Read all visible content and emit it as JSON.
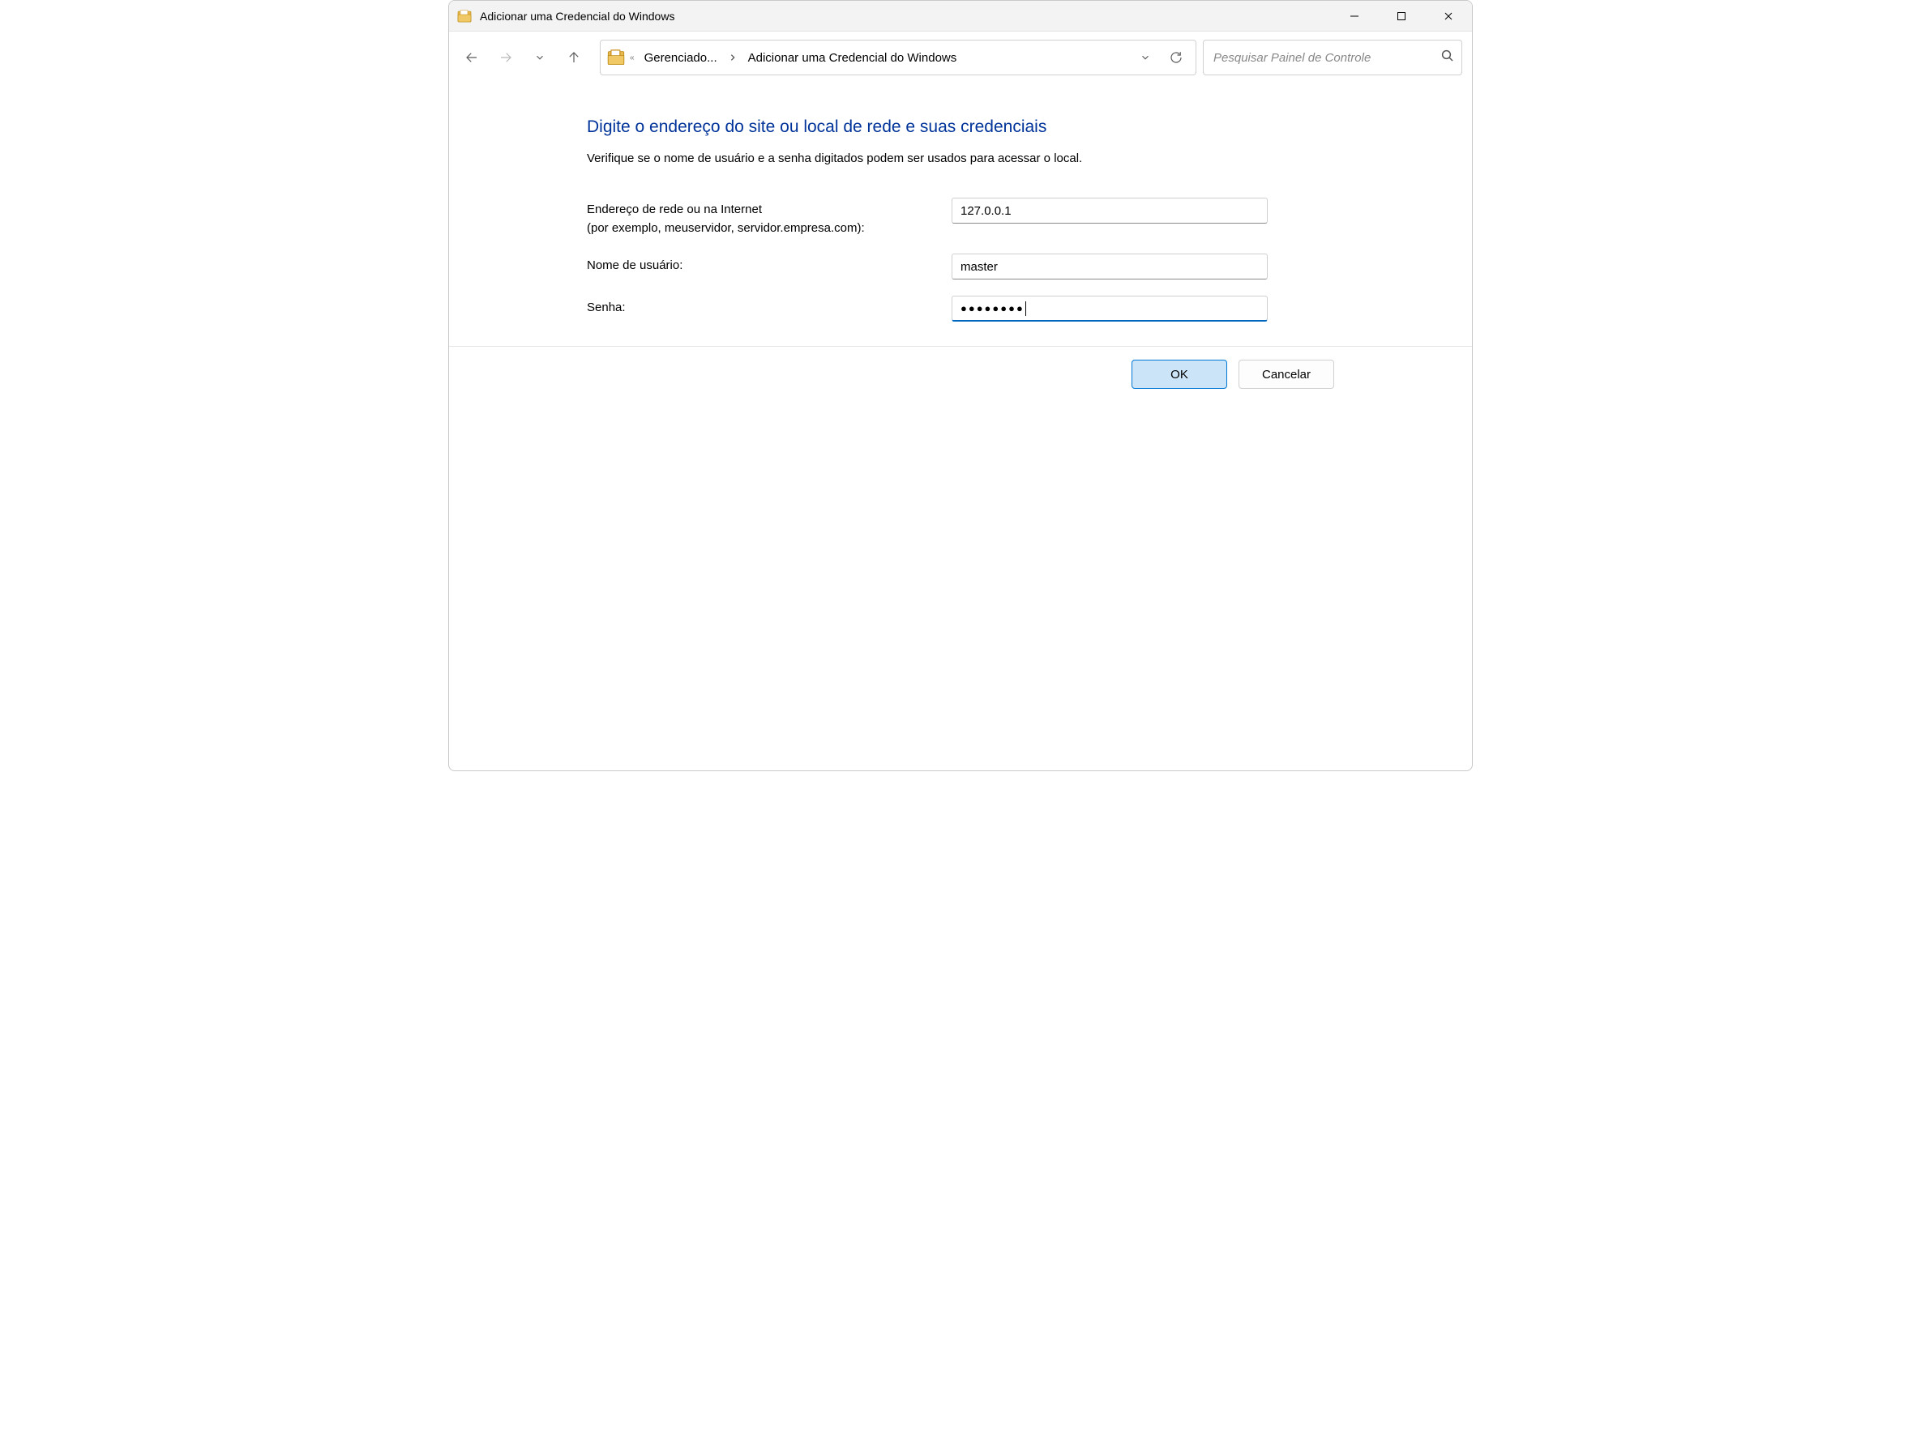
{
  "window": {
    "title": "Adicionar uma Credencial do Windows"
  },
  "breadcrumb": {
    "parent": "Gerenciado...",
    "current": "Adicionar uma Credencial do Windows"
  },
  "search": {
    "placeholder": "Pesquisar Painel de Controle"
  },
  "main": {
    "headline": "Digite o endereço do site ou local de rede e suas credenciais",
    "subtext": "Verifique se o nome de usuário e a senha digitados podem ser usados para acessar o local.",
    "address_label": "Endereço de rede ou na Internet",
    "address_hint": "(por exemplo, meuservidor, servidor.empresa.com):",
    "address_value": "127.0.0.1",
    "username_label": "Nome de usuário:",
    "username_value": "master",
    "password_label": "Senha:",
    "password_mask": "●●●●●●●●"
  },
  "buttons": {
    "ok": "OK",
    "cancel": "Cancelar"
  }
}
